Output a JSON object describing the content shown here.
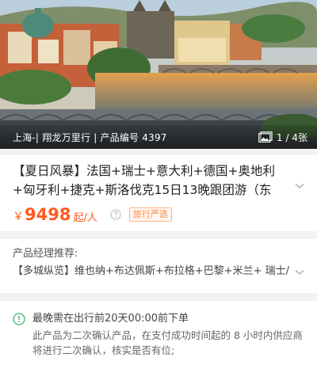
{
  "hero": {
    "caption": "上海-| 翔龙万里行 | 产品编号 4397",
    "photo_count": "1 / 4张",
    "photo_icon": "gallery-icon"
  },
  "product": {
    "title": "【夏日风暴】法国+瑞士+意大利+德国+奥地利+匈牙利+捷克+斯洛伐克15日13晚跟团游（东",
    "currency": "￥",
    "price": "9498",
    "price_unit": "起/人",
    "badge": "旅行严选",
    "price_info_icon": "question-circle-icon"
  },
  "recommend": {
    "label": "产品经理推荐:",
    "text": "【多城纵览】维也纳+布达佩斯+布拉格+巴黎+米兰+ 瑞士/"
  },
  "notice": {
    "icon": "info-circle-icon",
    "title": "最晚需在出行前20天00:00前下单",
    "body": "此产品为二次确认产品，在支付成功时间起的 8 小时内供应商将进行二次确认，核实是否有位;"
  },
  "colors": {
    "price": "#ff5a1f",
    "badge": "#ff8a3d",
    "notice_icon": "#3cb371",
    "page_bg": "#f2f2f2"
  }
}
